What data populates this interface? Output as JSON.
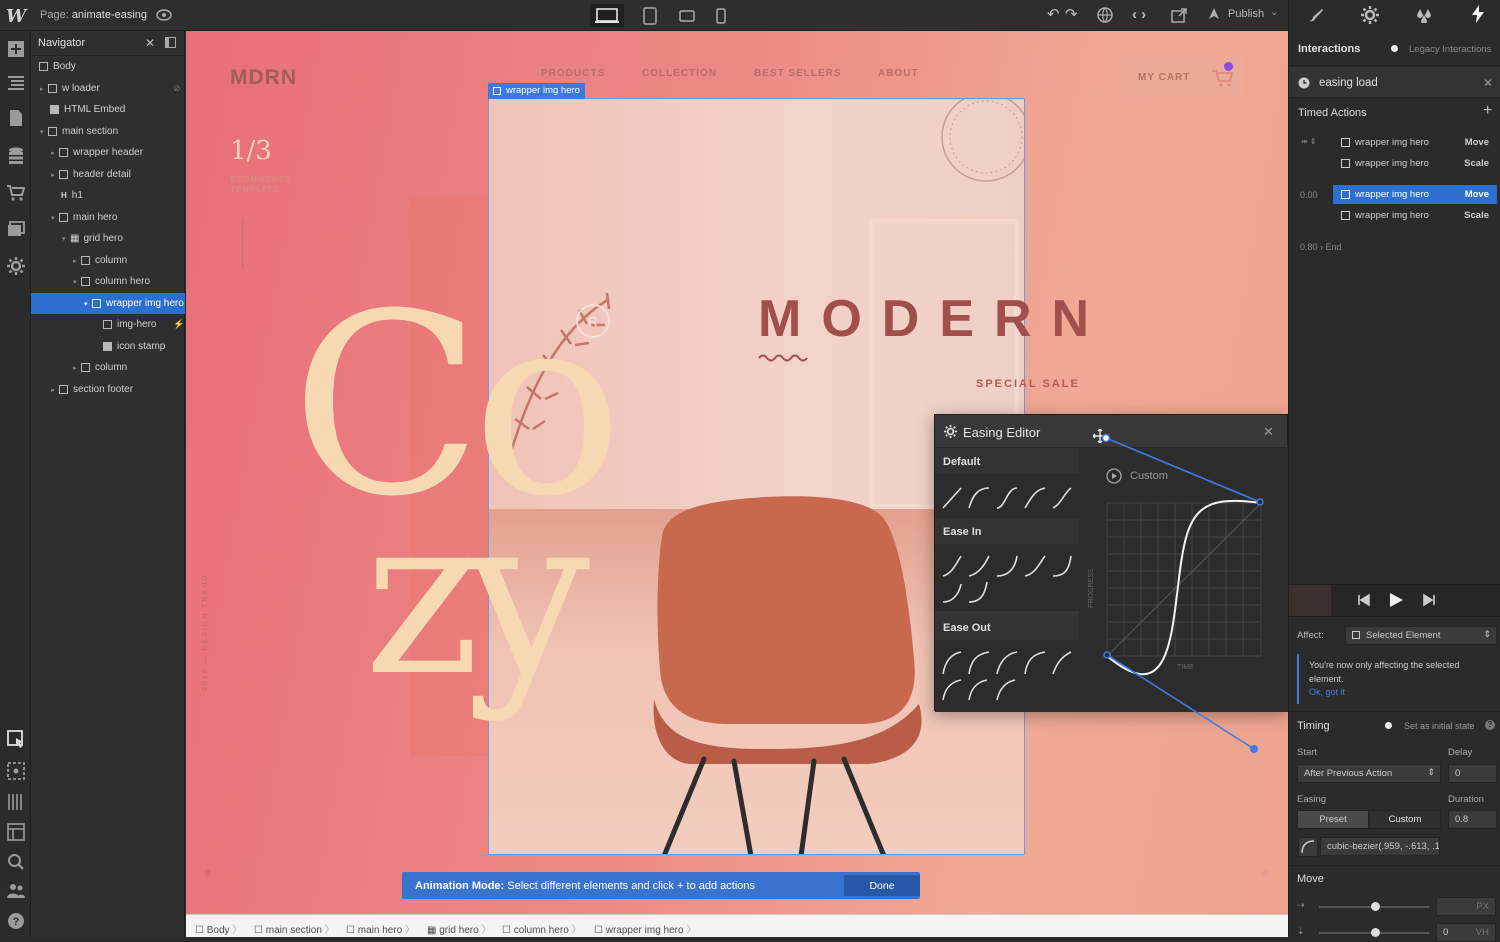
{
  "topbar": {
    "logo": "W",
    "page_prefix": "Page:",
    "page_name": "animate-easing",
    "publish_label": "Publish"
  },
  "navigator": {
    "title": "Navigator",
    "items": [
      {
        "label": "Body"
      },
      {
        "label": "w loader"
      },
      {
        "label": "HTML Embed"
      },
      {
        "label": "main section"
      },
      {
        "label": "wrapper header"
      },
      {
        "label": "header detail"
      },
      {
        "label": "h1"
      },
      {
        "label": "main hero"
      },
      {
        "label": "grid hero"
      },
      {
        "label": "column"
      },
      {
        "label": "column hero"
      },
      {
        "label": "wrapper img hero"
      },
      {
        "label": "img-hero"
      },
      {
        "label": "icon stamp"
      },
      {
        "label": "column"
      },
      {
        "label": "section footer"
      }
    ]
  },
  "canvas": {
    "brand": "MDRN",
    "nav_links": [
      "PRODUCTS",
      "COLLECTION",
      "BEST SELLERS",
      "ABOUT"
    ],
    "cart_label": "MY CART",
    "fraction": "1/3",
    "fraction_sub": "ECOMMERCE TEMPLATE",
    "cozy_1": "Co",
    "cozy_2": "zy",
    "modern": "MODERN",
    "special_sale": "SPECIAL SALE",
    "selected_tag": "wrapper img hero",
    "animation_mode_label": "Animation Mode:",
    "animation_mode_text": "Select different elements and click + to add actions",
    "done_label": "Done"
  },
  "breadcrumb": [
    "Body",
    "main section",
    "main hero",
    "grid hero",
    "column hero",
    "wrapper img hero"
  ],
  "easing_editor": {
    "title": "Easing Editor",
    "sections": [
      "Default",
      "Ease In",
      "Ease Out"
    ],
    "custom_label": "Custom",
    "y_axis_label": "PROGRESS",
    "x_axis_label": "TIME"
  },
  "right_panel": {
    "tab_interactions": "Interactions",
    "tab_legacy": "Legacy Interactions",
    "interaction_name": "easing load",
    "timed_actions_label": "Timed Actions",
    "time_1": "0.00",
    "time_2": "0.80",
    "end_label": "End",
    "actions": [
      {
        "target": "wrapper img hero",
        "action": "Move"
      },
      {
        "target": "wrapper img hero",
        "action": "Scale"
      },
      {
        "target": "wrapper img hero",
        "action": "Move"
      },
      {
        "target": "wrapper img hero",
        "action": "Scale"
      }
    ],
    "affect_label": "Affect:",
    "affect_value": "Selected Element",
    "notice_text": "You're now only affecting the selected element.",
    "notice_link": "Ok, got it",
    "timing_label": "Timing",
    "initial_state_label": "Set as initial state",
    "start_label": "Start",
    "delay_label": "Delay",
    "start_value": "After Previous Action",
    "delay_value": "0",
    "easing_label": "Easing",
    "duration_label": "Duration",
    "preset_label": "Preset",
    "custom_label": "Custom",
    "duration_value": "0.8",
    "bezier_value": "cubic-bezier(.959, -.613, .1",
    "move_label": "Move",
    "move_unit": "PX",
    "move_y_value": "0",
    "move_y_unit": "VH"
  },
  "colors": {
    "accent": "#2d6fd1",
    "canvas_left": "#e86f77",
    "canvas_right": "#f0a994",
    "cozy_text": "#f6d9b3",
    "modern_text": "#a14f4c"
  }
}
